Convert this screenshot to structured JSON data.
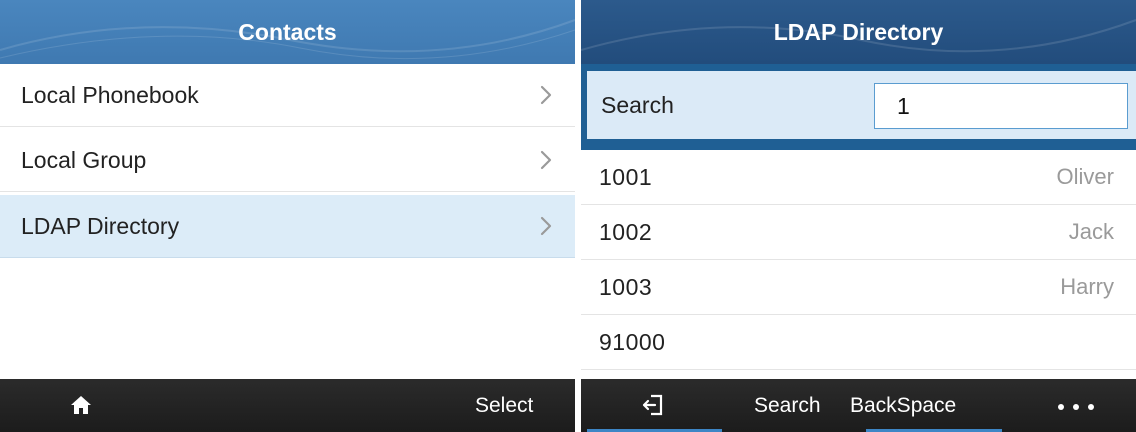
{
  "contacts": {
    "title": "Contacts",
    "items": [
      {
        "label": "Local Phonebook"
      },
      {
        "label": "Local Group"
      },
      {
        "label": "LDAP Directory"
      }
    ],
    "softkeys": {
      "home_icon": "home-icon",
      "select_label": "Select"
    }
  },
  "ldap": {
    "title": "LDAP Directory",
    "search": {
      "label": "Search",
      "value": "1"
    },
    "entries": [
      {
        "number": "1001",
        "name": "Oliver"
      },
      {
        "number": "1002",
        "name": "Jack"
      },
      {
        "number": "1003",
        "name": "Harry"
      },
      {
        "number": "91000",
        "name": ""
      }
    ],
    "softkeys": {
      "exit_icon": "exit-icon",
      "search_label": "Search",
      "backspace_label": "BackSpace",
      "more_icon": "more-icon"
    }
  },
  "colors": {
    "title_left": "#4a86be",
    "title_right": "#2c5a8c",
    "selected_row": "#dcecf8",
    "search_frame": "#1f5f94",
    "softbar": "#222222",
    "accent_underline": "#3d86c6"
  }
}
